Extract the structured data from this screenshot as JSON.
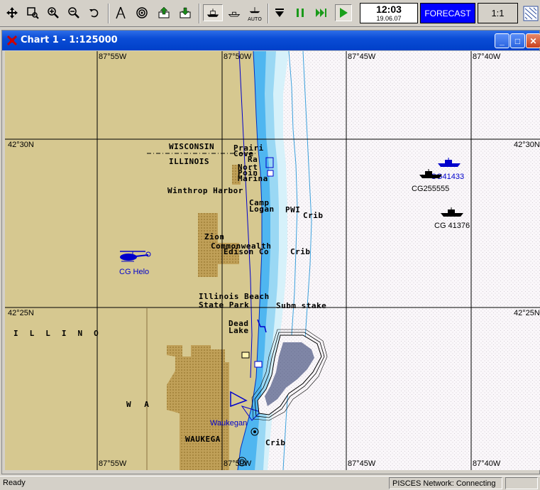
{
  "toolbar": {
    "auto_label": "AUTO",
    "time": "12:03",
    "date": "19.06.07",
    "forecast_label": "FORECAST",
    "scale_label": "1:1"
  },
  "window": {
    "title": "Chart 1 - 1:125000",
    "min_label": "_",
    "max_label": "□",
    "close_label": "✕"
  },
  "map": {
    "colors": {
      "land": "#d6c890",
      "town": "#b89a50",
      "shallow": "#4fb6f0",
      "mid": "#9ad8f4",
      "light": "#d6f1fa",
      "sea": "#faf7fa",
      "grid": "#000000",
      "vessel_blue": "#0000cc"
    },
    "coords": {
      "lon_top_1": "87°55W",
      "lon_top_2": "87°50W",
      "lon_top_3": "87°45W",
      "lon_top_4": "87°40W",
      "lon_bot_1": "87°55W",
      "lon_bot_2": "87°50W",
      "lon_bot_3": "87°45W",
      "lon_bot_4": "87°40W",
      "lat_1_left": "42°30N",
      "lat_1_right": "42°30N",
      "lat_2_left": "42°25N",
      "lat_2_right": "42°25N"
    },
    "labels": {
      "wisconsin": "WISCONSIN",
      "illinois": "ILLINOIS",
      "prairie": "Prairi",
      "cove": "Cove",
      "ra": "Ra",
      "north_point_marina_1": "Nort",
      "north_point_marina_2": "Poin",
      "north_point_marina_3": "Marina",
      "winthrop_harbor": "Winthrop Harbor",
      "camp": "Camp",
      "logan": "Logan",
      "pwi": "PWI",
      "crib_1": "Crib",
      "zion": "Zion",
      "commonwealth": "Commonwealth",
      "edison": "Edison Co",
      "crib_2": "Crib",
      "illinois_beach": "Illinois Beach",
      "state_park": "State Park",
      "subm_stake": "Subm stake",
      "dead": "Dead",
      "lake": "Lake",
      "illino_spaced": "ILLINO",
      "wa": "W A",
      "waukegan_town": "WAUKEGA",
      "crib_3": "Crib"
    },
    "vessels": {
      "cg_helo": "CG Helo",
      "cg41433": "CG41433",
      "cg255555": "CG255555",
      "cg41376": "CG 41376",
      "waukegan": "Waukegan"
    }
  },
  "status": {
    "ready": "Ready",
    "network": "PISCES Network: Connecting"
  }
}
